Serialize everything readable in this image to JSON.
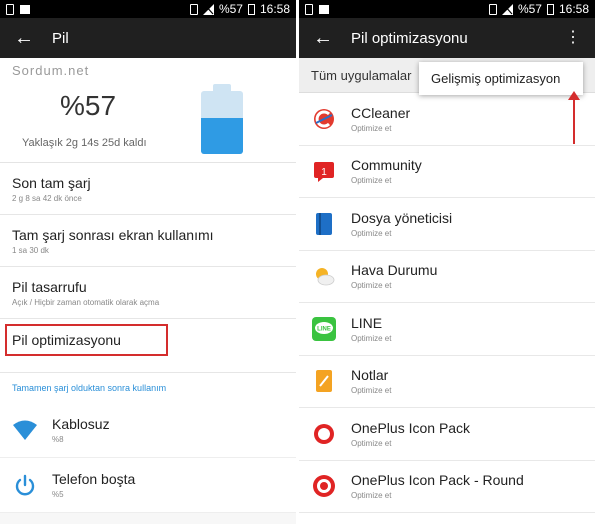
{
  "left": {
    "status": {
      "battery": "%57",
      "time": "16:58"
    },
    "appbar": {
      "back": "←",
      "title": "Pil"
    },
    "watermark": "Sordum.net",
    "summary": {
      "percent": "%57",
      "remaining": "Yaklaşık 2g 14s 25d kaldı",
      "level": 0.57
    },
    "rows": [
      {
        "title": "Son tam şarj",
        "subtitle": "2 g 8 sa 42 dk önce"
      },
      {
        "title": "Tam şarj sonrası ekran kullanımı",
        "subtitle": "1 sa 30 dk"
      },
      {
        "title": "Pil tasarrufu",
        "subtitle": "Açık / Hiçbir zaman otomatik olarak açma"
      }
    ],
    "optimization": "Pil optimizasyonu",
    "section": "Tamamen şarj olduktan sonra kullanım",
    "usage": [
      {
        "title": "Kablosuz",
        "subtitle": "%8",
        "icon": "wifi-icon"
      },
      {
        "title": "Telefon boşta",
        "subtitle": "%5",
        "icon": "power-icon"
      }
    ]
  },
  "right": {
    "status": {
      "battery": "%57",
      "time": "16:58"
    },
    "appbar": {
      "back": "←",
      "title": "Pil optimizasyonu",
      "menu": "⋮"
    },
    "filter": "Tüm uygulamalar",
    "popup": "Gelişmiş optimizasyon",
    "apps": [
      {
        "name": "CCleaner",
        "status": "Optimize et",
        "icon": "ccleaner-icon"
      },
      {
        "name": "Community",
        "status": "Optimize et",
        "icon": "community-icon"
      },
      {
        "name": "Dosya yöneticisi",
        "status": "Optimize et",
        "icon": "file-manager-icon"
      },
      {
        "name": "Hava Durumu",
        "status": "Optimize et",
        "icon": "weather-icon"
      },
      {
        "name": "LINE",
        "status": "Optimize et",
        "icon": "line-icon"
      },
      {
        "name": "Notlar",
        "status": "Optimize et",
        "icon": "notes-icon"
      },
      {
        "name": "OnePlus Icon Pack",
        "status": "Optimize et",
        "icon": "oneplus-icon"
      },
      {
        "name": "OnePlus Icon Pack - Round",
        "status": "Optimize et",
        "icon": "oneplus-round-icon"
      }
    ],
    "community_badge": "1"
  },
  "colors": {
    "accent": "#2a8fd8",
    "highlight": "#d42d2d",
    "battery_fill": "#2f9be4"
  }
}
